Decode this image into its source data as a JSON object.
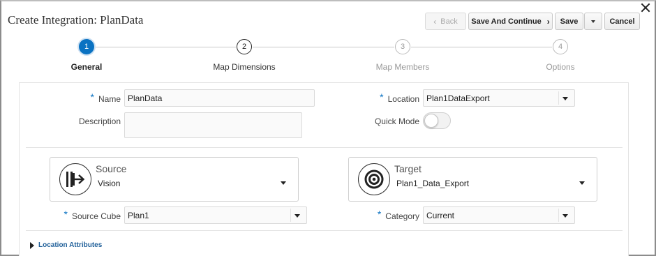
{
  "header": {
    "title": "Create Integration: PlanData",
    "close_icon": "close-icon"
  },
  "toolbar": {
    "back_label": "Back",
    "save_continue_label": "Save And Continue",
    "save_label": "Save",
    "cancel_label": "Cancel"
  },
  "steps": [
    {
      "number": "1",
      "label": "General",
      "state": "active"
    },
    {
      "number": "2",
      "label": "Map Dimensions",
      "state": "next"
    },
    {
      "number": "3",
      "label": "Map Members",
      "state": "future"
    },
    {
      "number": "4",
      "label": "Options",
      "state": "future"
    }
  ],
  "form": {
    "name": {
      "label": "Name",
      "value": "PlanData",
      "required": true
    },
    "description": {
      "label": "Description",
      "value": ""
    },
    "location": {
      "label": "Location",
      "value": "Plan1DataExport",
      "required": true
    },
    "quick_mode": {
      "label": "Quick Mode",
      "enabled": false
    }
  },
  "source": {
    "title": "Source",
    "value": "Vision",
    "icon": "source-arrow-icon",
    "cube_label": "Source Cube",
    "cube_value": "Plan1"
  },
  "target": {
    "title": "Target",
    "value": "Plan1_Data_Export",
    "icon": "target-icon",
    "category_label": "Category",
    "category_value": "Current"
  },
  "location_attributes": {
    "label": "Location Attributes"
  },
  "colors": {
    "accent": "#0a72c2",
    "link": "#1f5f99"
  }
}
